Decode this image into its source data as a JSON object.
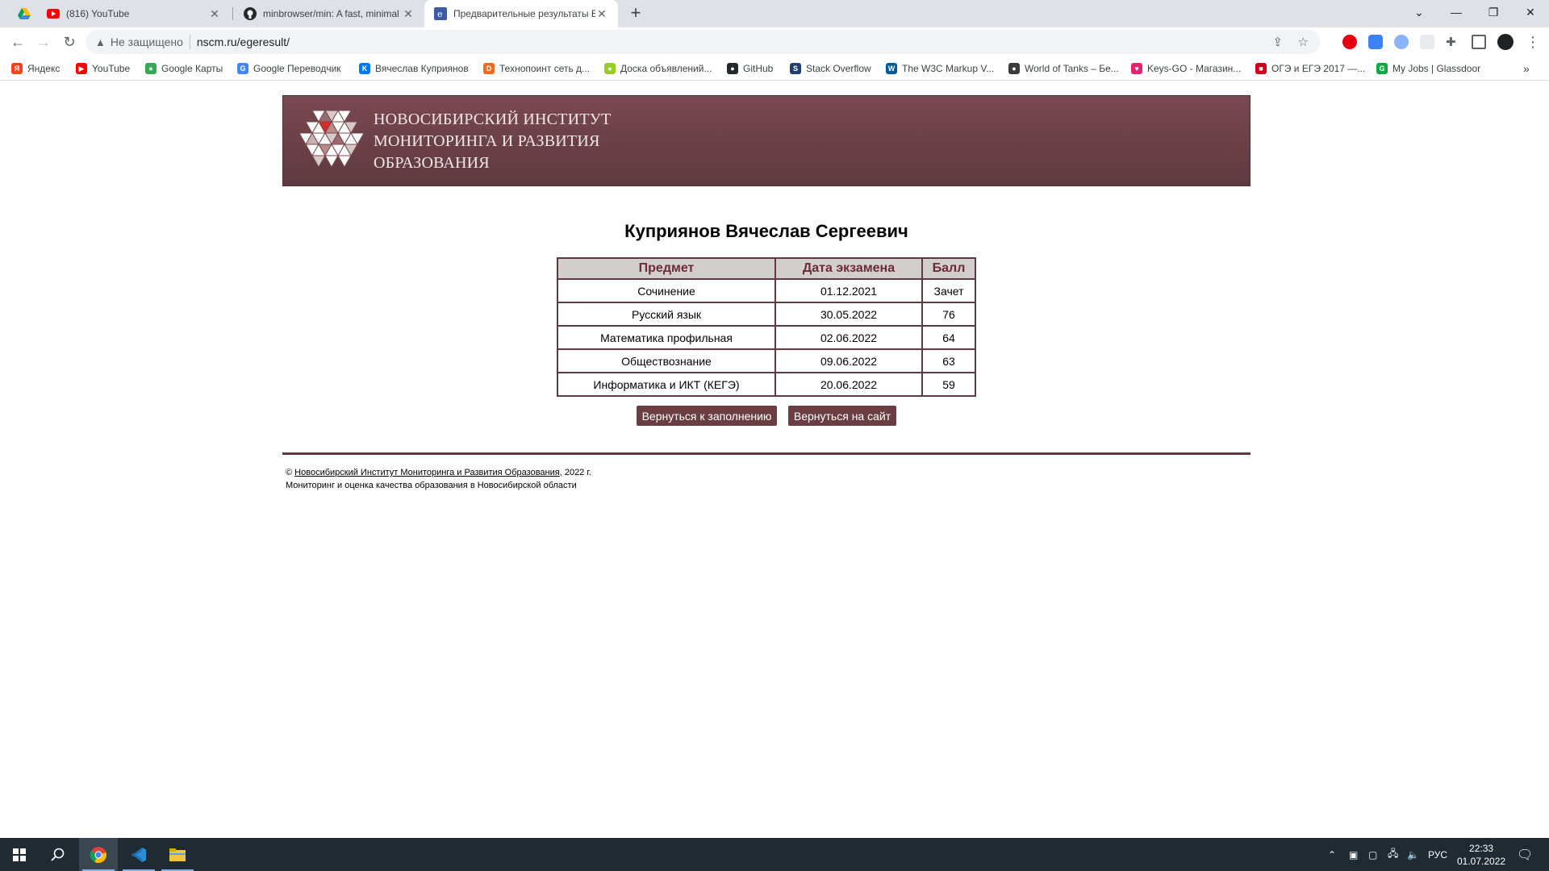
{
  "browser": {
    "tabs": [
      {
        "title": "(816) YouTube",
        "active": false,
        "icon": "youtube-icon"
      },
      {
        "title": "minbrowser/min: A fast, minimal",
        "active": false,
        "icon": "github-icon"
      },
      {
        "title": "Предварительные результаты Е",
        "active": true,
        "icon": "page-icon"
      }
    ],
    "insecure_label": "Не защищено",
    "url": "nscm.ru/egeresult/",
    "bookmarks": [
      {
        "label": "Яндекс",
        "color": "#fc3f1d",
        "glyph": "Я"
      },
      {
        "label": "YouTube",
        "color": "#ff0000",
        "glyph": "▶"
      },
      {
        "label": "Google Карты",
        "color": "#34a853",
        "glyph": "●"
      },
      {
        "label": "Google Переводчик",
        "color": "#4285f4",
        "glyph": "G"
      },
      {
        "label": "Вячеслав Куприянов",
        "color": "#0077ff",
        "glyph": "K"
      },
      {
        "label": "Технопоинт сеть д...",
        "color": "#f26a21",
        "glyph": "D"
      },
      {
        "label": "Доска объявлений...",
        "color": "#97cf26",
        "glyph": "●"
      },
      {
        "label": "GitHub",
        "color": "#24292e",
        "glyph": "●"
      },
      {
        "label": "Stack Overflow",
        "color": "#1f3f73",
        "glyph": "S"
      },
      {
        "label": "The W3C Markup V...",
        "color": "#005a9c",
        "glyph": "W"
      },
      {
        "label": "World of Tanks – Бе...",
        "color": "#3b3b3b",
        "glyph": "●"
      },
      {
        "label": "Keys-GO - Магазин...",
        "color": "#e8206f",
        "glyph": "♥"
      },
      {
        "label": "ОГЭ и ЕГЭ 2017 —...",
        "color": "#d0021b",
        "glyph": "■"
      },
      {
        "label": "My Jobs | Glassdoor",
        "color": "#0caa41",
        "glyph": "G"
      }
    ]
  },
  "page": {
    "institute": {
      "line1": "НОВОСИБИРСКИЙ ИНСТИТУТ",
      "line2": "МОНИТОРИНГА И РАЗВИТИЯ",
      "line3": "ОБРАЗОВАНИЯ"
    },
    "person_name": "Куприянов Вячеслав Сергеевич",
    "table": {
      "headers": [
        "Предмет",
        "Дата экзамена",
        "Балл"
      ],
      "rows": [
        [
          "Сочинение",
          "01.12.2021",
          "Зачет"
        ],
        [
          "Русский язык",
          "30.05.2022",
          "76"
        ],
        [
          "Математика профильная",
          "02.06.2022",
          "64"
        ],
        [
          "Обществознание",
          "09.06.2022",
          "63"
        ],
        [
          "Информатика и ИКТ (КЕГЭ)",
          "20.06.2022",
          "59"
        ]
      ]
    },
    "buttons": {
      "back_to_form": "Вернуться к заполнению",
      "back_to_site": "Вернуться на сайт"
    },
    "footer": {
      "copyright_symbol": "©",
      "link": "Новосибирский Институт Мониторинга и Развития Образования",
      "year": ", 2022 г.",
      "line2": "Мониторинг и оценка качества образования в Новосибирской области"
    }
  },
  "taskbar": {
    "lang": "РУС",
    "time": "22:33",
    "date": "01.07.2022"
  },
  "colors": {
    "banner": "#6b3e44",
    "table_border": "#5e3a40",
    "header_bg": "#d2cecd",
    "header_text": "#6b2c36",
    "button_bg": "#6b3e44"
  }
}
